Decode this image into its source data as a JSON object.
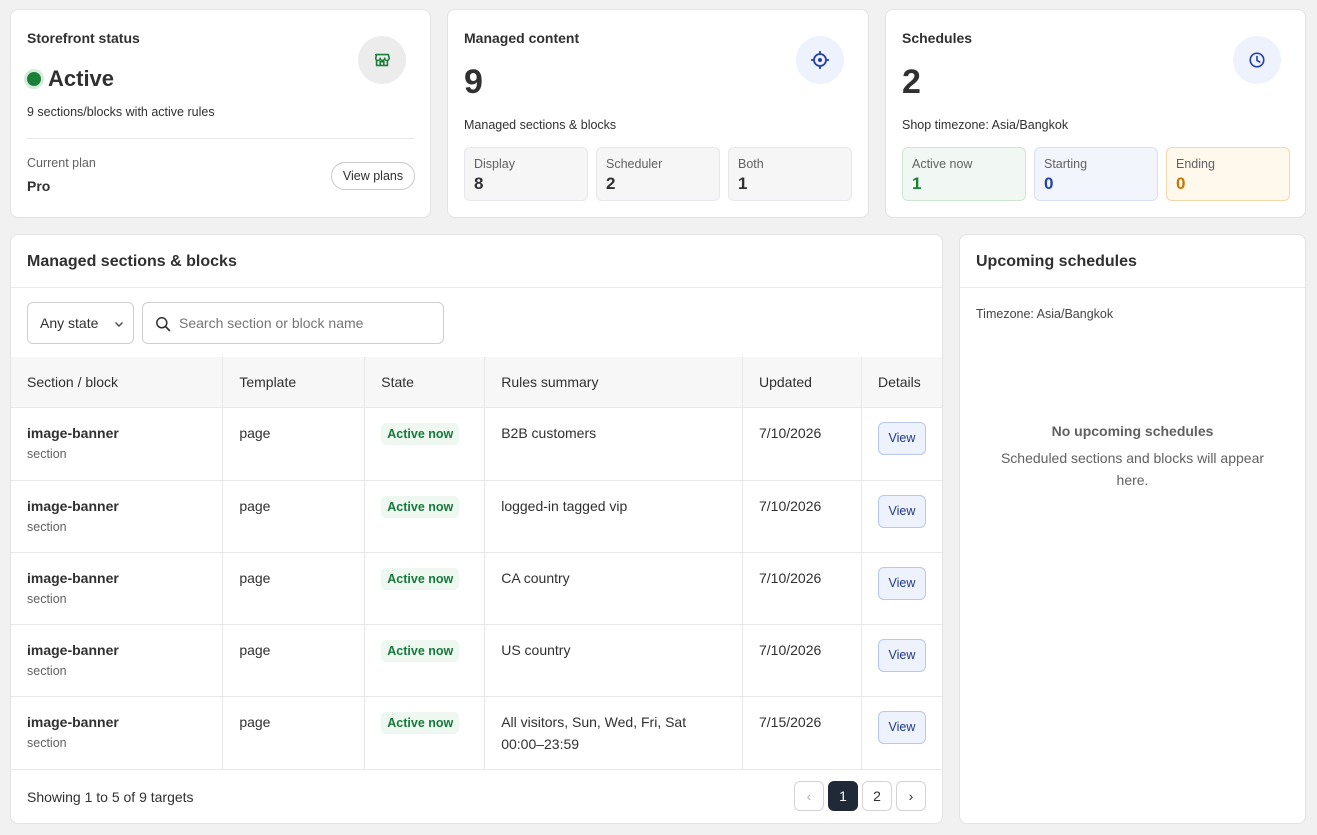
{
  "storefront": {
    "title": "Storefront status",
    "status": "Active",
    "description": "9 sections/blocks with active rules",
    "plan_label": "Current plan",
    "plan_value": "Pro",
    "view_plans": "View plans"
  },
  "managed": {
    "title": "Managed content",
    "count": "9",
    "subtitle": "Managed sections & blocks",
    "stats": [
      {
        "label": "Display",
        "value": "8"
      },
      {
        "label": "Scheduler",
        "value": "2"
      },
      {
        "label": "Both",
        "value": "1"
      }
    ]
  },
  "schedules": {
    "title": "Schedules",
    "count": "2",
    "timezone": "Shop timezone: Asia/Bangkok",
    "stats": [
      {
        "label": "Active now",
        "value": "1"
      },
      {
        "label": "Starting",
        "value": "0"
      },
      {
        "label": "Ending",
        "value": "0"
      }
    ]
  },
  "table_card": {
    "title": "Managed sections & blocks",
    "state_filter": "Any state",
    "search_placeholder": "Search section or block name",
    "columns": [
      "Section / block",
      "Template",
      "State",
      "Rules summary",
      "Updated",
      "Details"
    ],
    "rows": [
      {
        "name": "image-banner",
        "kind": "section",
        "template": "page",
        "state": "Active now",
        "rules": "B2B customers",
        "updated": "7/10/2026",
        "action": "View"
      },
      {
        "name": "image-banner",
        "kind": "section",
        "template": "page",
        "state": "Active now",
        "rules": "logged-in tagged vip",
        "updated": "7/10/2026",
        "action": "View"
      },
      {
        "name": "image-banner",
        "kind": "section",
        "template": "page",
        "state": "Active now",
        "rules": "CA country",
        "updated": "7/10/2026",
        "action": "View"
      },
      {
        "name": "image-banner",
        "kind": "section",
        "template": "page",
        "state": "Active now",
        "rules": "US country",
        "updated": "7/10/2026",
        "action": "View"
      },
      {
        "name": "image-banner",
        "kind": "section",
        "template": "page",
        "state": "Active now",
        "rules": "All visitors, Sun, Wed, Fri, Sat 00:00–23:59",
        "updated": "7/15/2026",
        "action": "View"
      }
    ],
    "footer": "Showing 1 to 5 of 9 targets",
    "pagination": {
      "prev": "‹",
      "pages": [
        "1",
        "2"
      ],
      "next": "›",
      "current": "1"
    }
  },
  "upcoming": {
    "title": "Upcoming schedules",
    "timezone": "Timezone: Asia/Bangkok",
    "empty_title": "No upcoming schedules",
    "empty_desc": "Scheduled sections and blocks will appear here."
  },
  "colors": {
    "active_green": "#1a7f37",
    "accent_blue": "#1f3a8a",
    "ending_orange": "#c77700"
  }
}
